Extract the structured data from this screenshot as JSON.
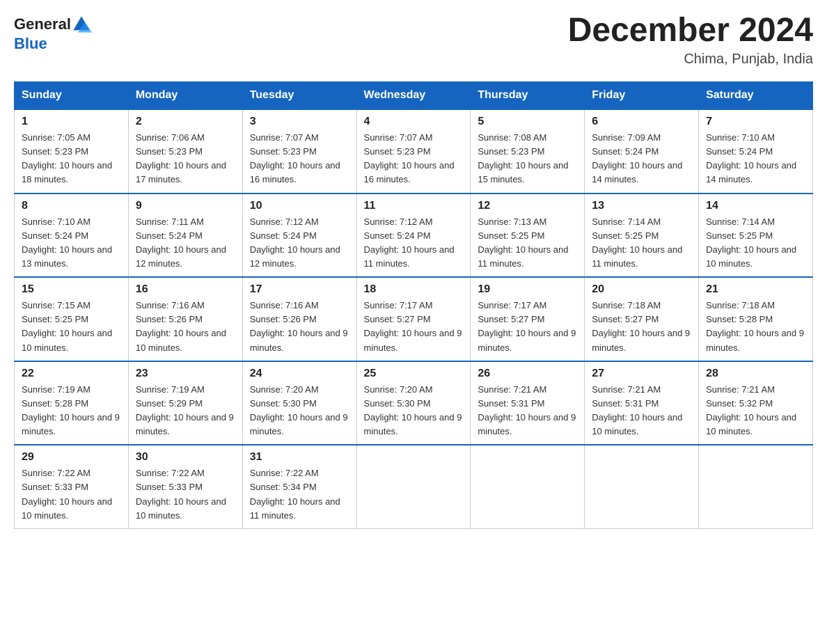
{
  "header": {
    "logo_general": "General",
    "logo_blue": "Blue",
    "month_title": "December 2024",
    "location": "Chima, Punjab, India"
  },
  "columns": [
    "Sunday",
    "Monday",
    "Tuesday",
    "Wednesday",
    "Thursday",
    "Friday",
    "Saturday"
  ],
  "weeks": [
    [
      {
        "day": "1",
        "sunrise": "7:05 AM",
        "sunset": "5:23 PM",
        "daylight": "10 hours and 18 minutes."
      },
      {
        "day": "2",
        "sunrise": "7:06 AM",
        "sunset": "5:23 PM",
        "daylight": "10 hours and 17 minutes."
      },
      {
        "day": "3",
        "sunrise": "7:07 AM",
        "sunset": "5:23 PM",
        "daylight": "10 hours and 16 minutes."
      },
      {
        "day": "4",
        "sunrise": "7:07 AM",
        "sunset": "5:23 PM",
        "daylight": "10 hours and 16 minutes."
      },
      {
        "day": "5",
        "sunrise": "7:08 AM",
        "sunset": "5:23 PM",
        "daylight": "10 hours and 15 minutes."
      },
      {
        "day": "6",
        "sunrise": "7:09 AM",
        "sunset": "5:24 PM",
        "daylight": "10 hours and 14 minutes."
      },
      {
        "day": "7",
        "sunrise": "7:10 AM",
        "sunset": "5:24 PM",
        "daylight": "10 hours and 14 minutes."
      }
    ],
    [
      {
        "day": "8",
        "sunrise": "7:10 AM",
        "sunset": "5:24 PM",
        "daylight": "10 hours and 13 minutes."
      },
      {
        "day": "9",
        "sunrise": "7:11 AM",
        "sunset": "5:24 PM",
        "daylight": "10 hours and 12 minutes."
      },
      {
        "day": "10",
        "sunrise": "7:12 AM",
        "sunset": "5:24 PM",
        "daylight": "10 hours and 12 minutes."
      },
      {
        "day": "11",
        "sunrise": "7:12 AM",
        "sunset": "5:24 PM",
        "daylight": "10 hours and 11 minutes."
      },
      {
        "day": "12",
        "sunrise": "7:13 AM",
        "sunset": "5:25 PM",
        "daylight": "10 hours and 11 minutes."
      },
      {
        "day": "13",
        "sunrise": "7:14 AM",
        "sunset": "5:25 PM",
        "daylight": "10 hours and 11 minutes."
      },
      {
        "day": "14",
        "sunrise": "7:14 AM",
        "sunset": "5:25 PM",
        "daylight": "10 hours and 10 minutes."
      }
    ],
    [
      {
        "day": "15",
        "sunrise": "7:15 AM",
        "sunset": "5:25 PM",
        "daylight": "10 hours and 10 minutes."
      },
      {
        "day": "16",
        "sunrise": "7:16 AM",
        "sunset": "5:26 PM",
        "daylight": "10 hours and 10 minutes."
      },
      {
        "day": "17",
        "sunrise": "7:16 AM",
        "sunset": "5:26 PM",
        "daylight": "10 hours and 9 minutes."
      },
      {
        "day": "18",
        "sunrise": "7:17 AM",
        "sunset": "5:27 PM",
        "daylight": "10 hours and 9 minutes."
      },
      {
        "day": "19",
        "sunrise": "7:17 AM",
        "sunset": "5:27 PM",
        "daylight": "10 hours and 9 minutes."
      },
      {
        "day": "20",
        "sunrise": "7:18 AM",
        "sunset": "5:27 PM",
        "daylight": "10 hours and 9 minutes."
      },
      {
        "day": "21",
        "sunrise": "7:18 AM",
        "sunset": "5:28 PM",
        "daylight": "10 hours and 9 minutes."
      }
    ],
    [
      {
        "day": "22",
        "sunrise": "7:19 AM",
        "sunset": "5:28 PM",
        "daylight": "10 hours and 9 minutes."
      },
      {
        "day": "23",
        "sunrise": "7:19 AM",
        "sunset": "5:29 PM",
        "daylight": "10 hours and 9 minutes."
      },
      {
        "day": "24",
        "sunrise": "7:20 AM",
        "sunset": "5:30 PM",
        "daylight": "10 hours and 9 minutes."
      },
      {
        "day": "25",
        "sunrise": "7:20 AM",
        "sunset": "5:30 PM",
        "daylight": "10 hours and 9 minutes."
      },
      {
        "day": "26",
        "sunrise": "7:21 AM",
        "sunset": "5:31 PM",
        "daylight": "10 hours and 9 minutes."
      },
      {
        "day": "27",
        "sunrise": "7:21 AM",
        "sunset": "5:31 PM",
        "daylight": "10 hours and 10 minutes."
      },
      {
        "day": "28",
        "sunrise": "7:21 AM",
        "sunset": "5:32 PM",
        "daylight": "10 hours and 10 minutes."
      }
    ],
    [
      {
        "day": "29",
        "sunrise": "7:22 AM",
        "sunset": "5:33 PM",
        "daylight": "10 hours and 10 minutes."
      },
      {
        "day": "30",
        "sunrise": "7:22 AM",
        "sunset": "5:33 PM",
        "daylight": "10 hours and 10 minutes."
      },
      {
        "day": "31",
        "sunrise": "7:22 AM",
        "sunset": "5:34 PM",
        "daylight": "10 hours and 11 minutes."
      },
      null,
      null,
      null,
      null
    ]
  ]
}
